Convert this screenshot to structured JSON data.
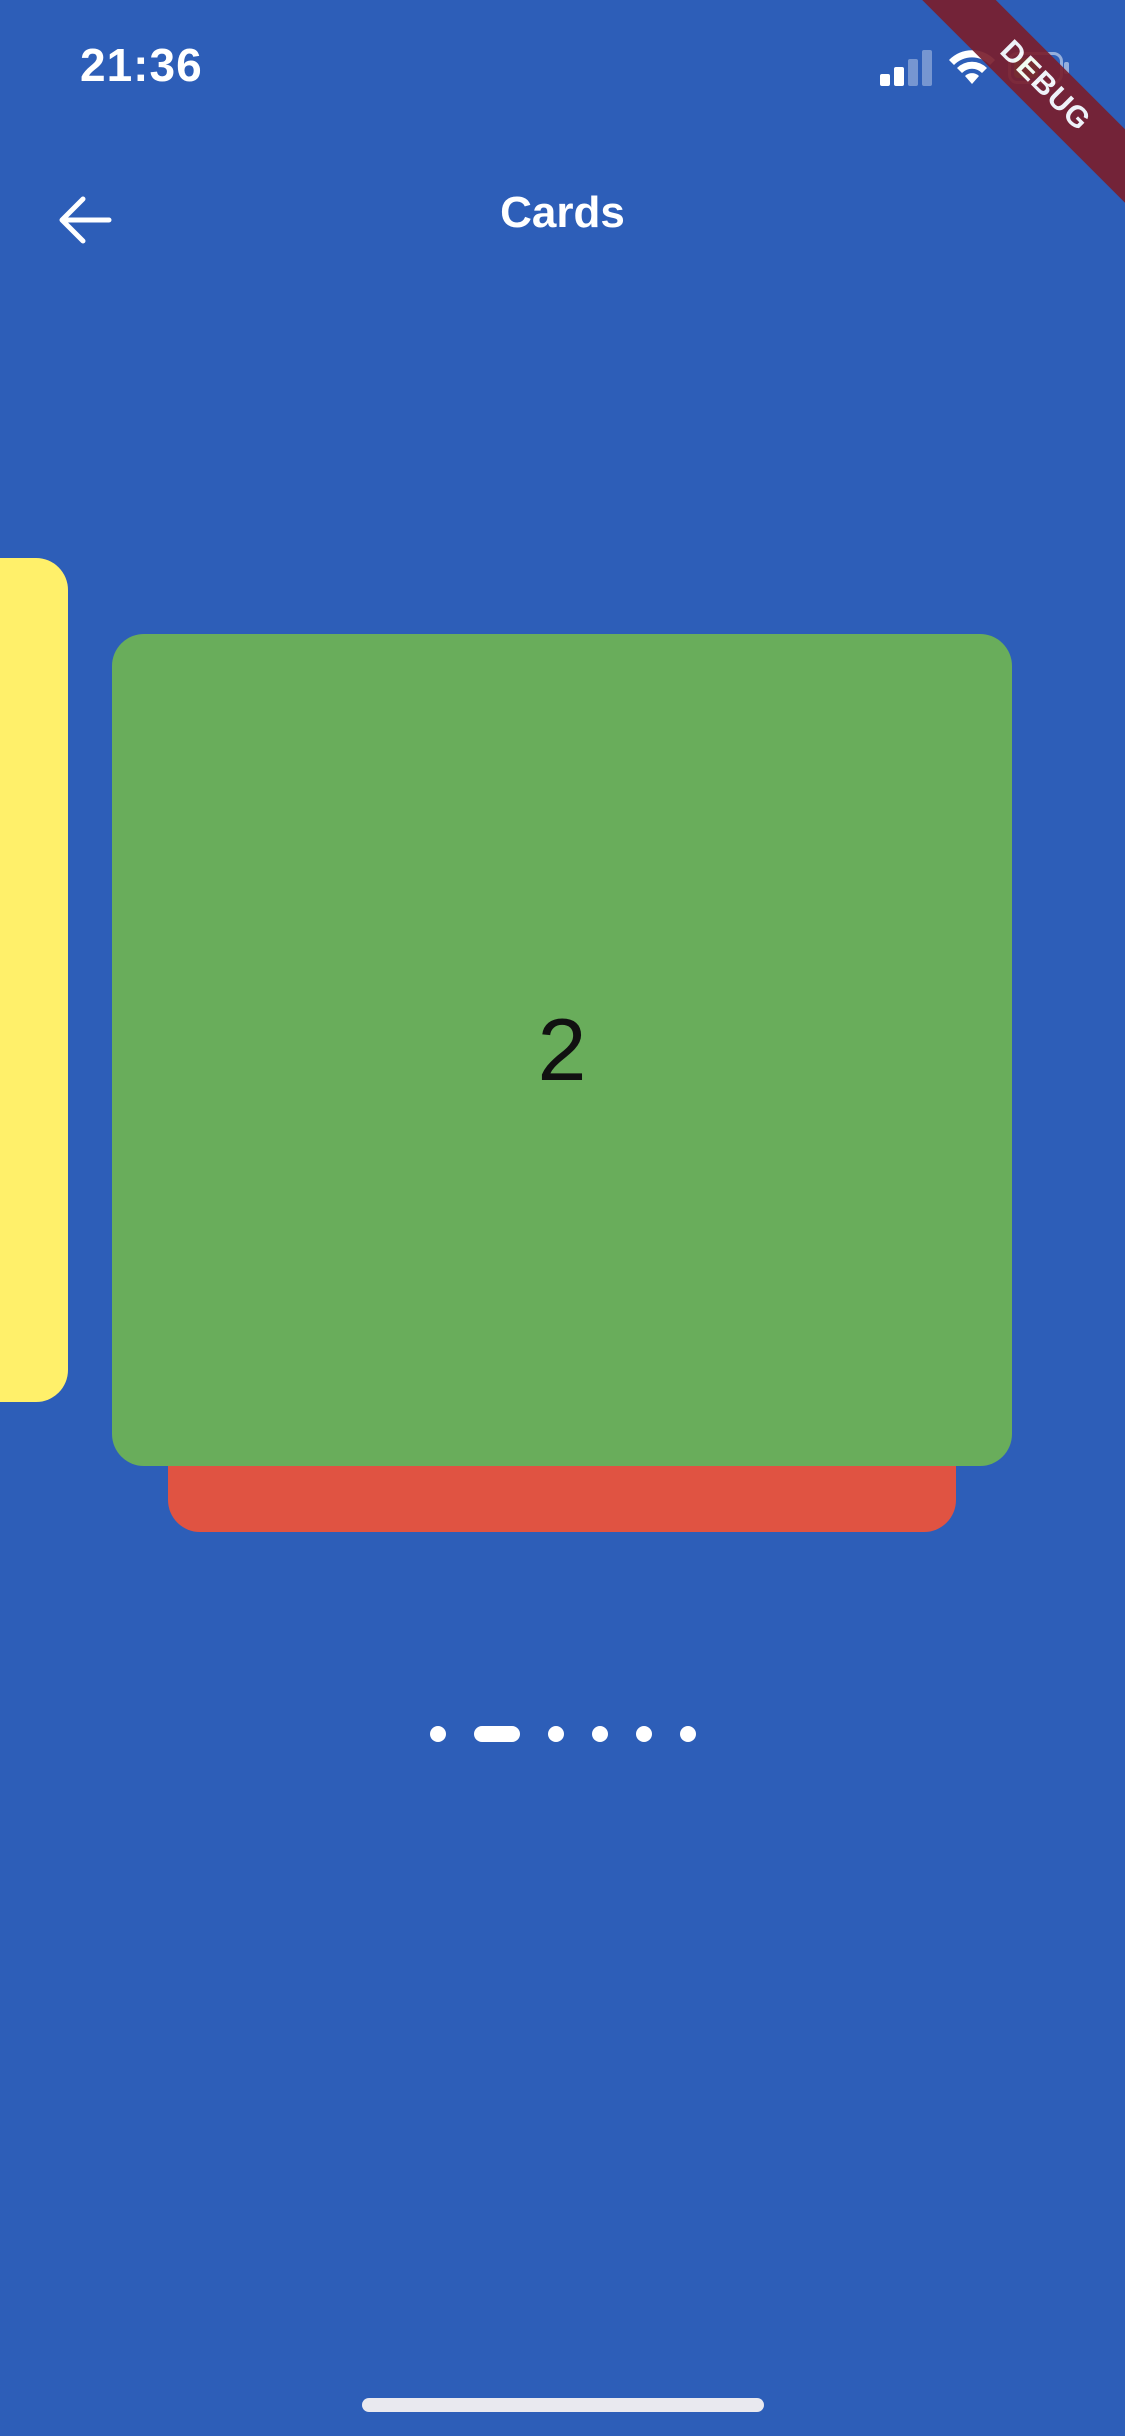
{
  "status_bar": {
    "time": "21:36",
    "icons": [
      "signal-icon",
      "wifi-icon",
      "battery-icon"
    ]
  },
  "debug_banner": {
    "label": "DEBUG"
  },
  "app_bar": {
    "back_icon": "arrow-left-icon",
    "title": "Cards"
  },
  "carousel": {
    "current_card_label": "2",
    "cards": [
      {
        "color": "#fff06a"
      },
      {
        "color": "#69ad5b"
      },
      {
        "color": "#e05342"
      }
    ],
    "page_count": 6,
    "active_page_index": 1
  },
  "colors": {
    "background": "#2d5eb8",
    "card_yellow": "#fff06a",
    "card_green": "#69ad5b",
    "card_red": "#e05342",
    "banner": "#7a1f2e"
  }
}
